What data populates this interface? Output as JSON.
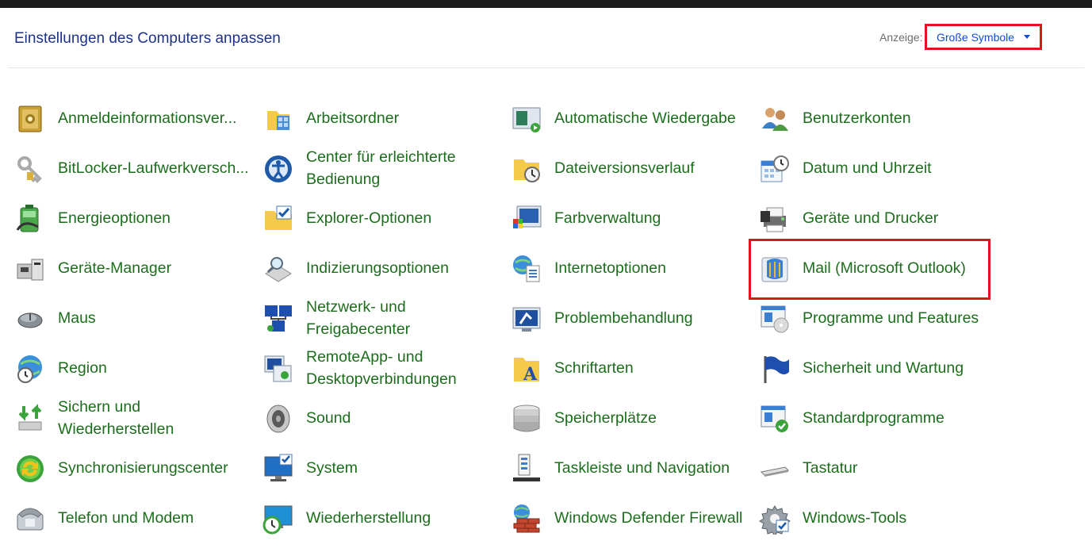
{
  "header": {
    "title": "Einstellungen des Computers anpassen",
    "view_label": "Anzeige:",
    "view_value": "Große Symbole"
  },
  "items": [
    {
      "label": "Anmeldeinformationsver...",
      "icon": "safe-icon"
    },
    {
      "label": "Arbeitsordner",
      "icon": "work-folder-icon"
    },
    {
      "label": "Automatische Wiedergabe",
      "icon": "autoplay-icon"
    },
    {
      "label": "Benutzerkonten",
      "icon": "users-icon"
    },
    {
      "label": "BitLocker-Laufwerkversch...",
      "icon": "keys-icon"
    },
    {
      "label": "Center für erleichterte Bedienung",
      "icon": "ease-of-access-icon"
    },
    {
      "label": "Dateiversionsverlauf",
      "icon": "file-history-icon"
    },
    {
      "label": "Datum und Uhrzeit",
      "icon": "calendar-clock-icon"
    },
    {
      "label": "Energieoptionen",
      "icon": "battery-icon"
    },
    {
      "label": "Explorer-Optionen",
      "icon": "folder-check-icon"
    },
    {
      "label": "Farbverwaltung",
      "icon": "color-management-icon"
    },
    {
      "label": "Geräte und Drucker",
      "icon": "printer-icon"
    },
    {
      "label": "Geräte-Manager",
      "icon": "device-manager-icon"
    },
    {
      "label": "Indizierungsoptionen",
      "icon": "indexing-icon"
    },
    {
      "label": "Internetoptionen",
      "icon": "globe-document-icon"
    },
    {
      "label": "Mail (Microsoft Outlook)",
      "icon": "mail-icon"
    },
    {
      "label": "Maus",
      "icon": "mouse-icon"
    },
    {
      "label": "Netzwerk- und Freigabecenter",
      "icon": "network-icon"
    },
    {
      "label": "Problembehandlung",
      "icon": "troubleshoot-icon"
    },
    {
      "label": "Programme und Features",
      "icon": "programs-icon"
    },
    {
      "label": "Region",
      "icon": "globe-clock-icon"
    },
    {
      "label": "RemoteApp- und Desktopverbindungen",
      "icon": "remote-desktop-icon"
    },
    {
      "label": "Schriftarten",
      "icon": "fonts-icon"
    },
    {
      "label": "Sicherheit und Wartung",
      "icon": "flag-icon"
    },
    {
      "label": "Sichern und Wiederherstellen",
      "icon": "backup-icon"
    },
    {
      "label": "Sound",
      "icon": "speaker-icon"
    },
    {
      "label": "Speicherplätze",
      "icon": "storage-icon"
    },
    {
      "label": "Standardprogramme",
      "icon": "default-programs-icon"
    },
    {
      "label": "Synchronisierungscenter",
      "icon": "sync-icon"
    },
    {
      "label": "System",
      "icon": "monitor-check-icon"
    },
    {
      "label": "Taskleiste und Navigation",
      "icon": "taskbar-icon"
    },
    {
      "label": "Tastatur",
      "icon": "keyboard-icon"
    },
    {
      "label": "Telefon und Modem",
      "icon": "phone-icon"
    },
    {
      "label": "Wiederherstellung",
      "icon": "recovery-icon"
    },
    {
      "label": "Windows Defender Firewall",
      "icon": "firewall-icon"
    },
    {
      "label": "Windows-Tools",
      "icon": "gear-icon"
    }
  ],
  "colors": {
    "link_green": "#1c6d1c",
    "title_blue": "#1e3287",
    "dropdown_blue": "#0b4fd3",
    "highlight_red": "#e0141e"
  }
}
